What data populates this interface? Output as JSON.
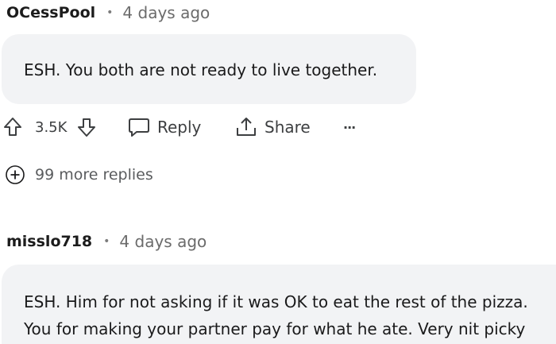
{
  "comments": [
    {
      "author": "OCessPool",
      "separator": "•",
      "time": "4 days ago",
      "body_lines": [
        "ESH. You both are not ready to live together."
      ]
    },
    {
      "author": "misslo718",
      "separator": "•",
      "time": "4 days ago",
      "body_lines": [
        "ESH. Him for not asking if it was OK to eat the rest of the pizza.",
        "You for making your partner pay for what he ate. Very nit picky"
      ]
    }
  ],
  "actions": {
    "score": "3.5K",
    "reply_label": "Reply",
    "share_label": "Share",
    "more_label": "···"
  },
  "more_replies": {
    "label": "99 more replies"
  },
  "icons": {
    "upvote": "arrow-up-icon",
    "downvote": "arrow-down-icon",
    "reply": "speech-bubble-icon",
    "share": "share-icon",
    "more": "ellipsis-icon",
    "expand": "plus-circle-icon"
  }
}
